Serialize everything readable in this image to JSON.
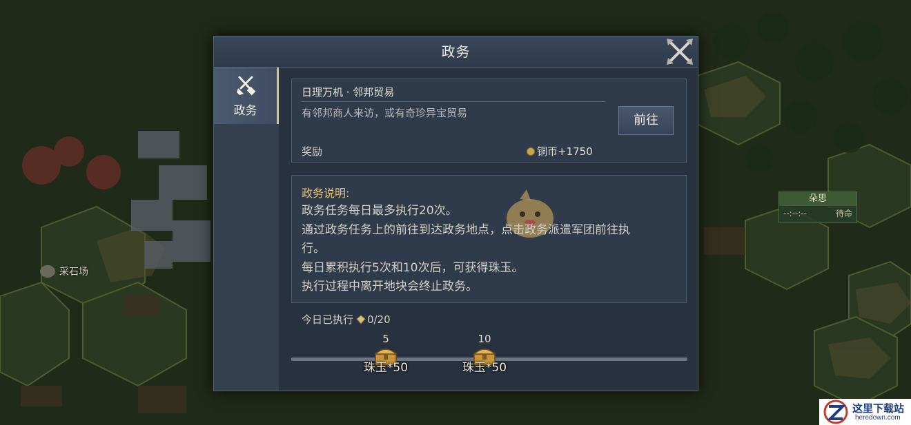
{
  "map": {
    "location_label": "采石场",
    "unit_tag_name": "朵思",
    "unit_tag_coords": "--:--:--",
    "unit_tag_status": "待命"
  },
  "dialog": {
    "title": "政务",
    "close_icon": "crossed-swords-close-icon"
  },
  "sidebar": {
    "tabs": [
      {
        "label": "政务",
        "icon": "brush-scroll-icon",
        "selected": true
      }
    ]
  },
  "task": {
    "title": "日理万机 · 邻邦贸易",
    "description": "有邻邦商人来访，或有奇珍异宝贸易",
    "goto_label": "前往",
    "reward_label": "奖励",
    "reward_value": "铜币+1750",
    "reward_icon": "copper-coin-icon"
  },
  "explanation": {
    "heading": "政务说明:",
    "lines": [
      "政务任务每日最多执行20次。",
      "通过政务任务上的前往到达政务地点，点击政务派遣军团前往执",
      "行。",
      "每日累积执行5次和10次后，可获得珠玉。",
      "执行过程中离开地块会终止政务。"
    ]
  },
  "progress": {
    "label": "今日已执行",
    "value": "0/20",
    "current": 0,
    "max": 20,
    "milestones": [
      {
        "count": "5",
        "reward": "珠玉*50",
        "icon": "treasure-chest-icon"
      },
      {
        "count": "10",
        "reward": "珠玉*50",
        "icon": "treasure-chest-icon"
      }
    ]
  },
  "watermark": {
    "text": "这里下载站",
    "url_text": "heredown.com"
  },
  "colors": {
    "panel": "#2b3646",
    "accent_gold": "#d6c37d",
    "heading_gold": "#e3c27a"
  }
}
